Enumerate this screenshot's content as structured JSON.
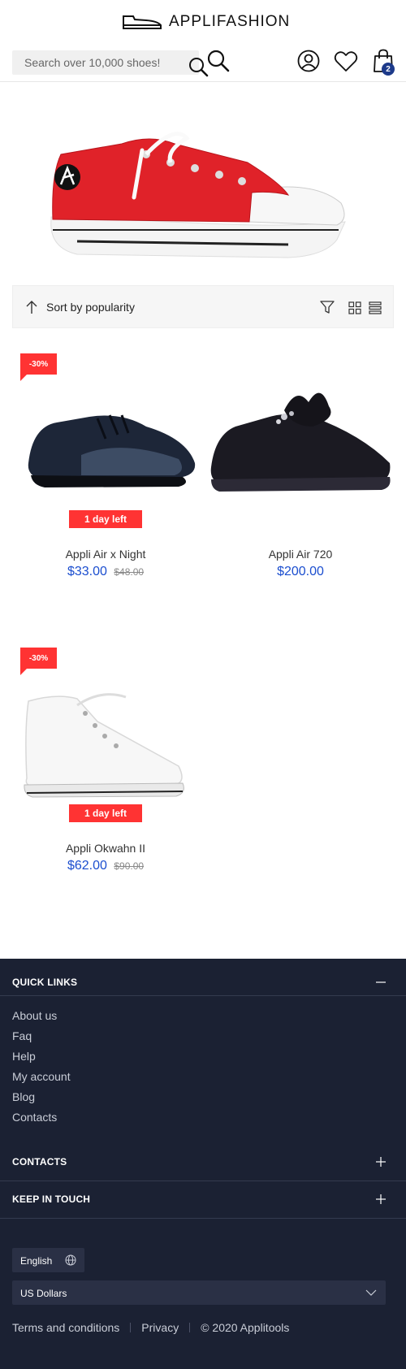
{
  "header": {
    "logo_text": "APPLIFASHION",
    "search_placeholder": "Search over 10,000 shoes!",
    "cart_count": "2",
    "icons": [
      "shoe-logo-icon",
      "search-icon",
      "account-icon",
      "heart-icon",
      "shopping-bag-icon"
    ]
  },
  "sortbar": {
    "label": "Sort by popularity",
    "icons": [
      "sort-arrow-icon",
      "filter-icon",
      "grid-view-icon",
      "list-view-icon"
    ]
  },
  "products": [
    {
      "discount": "-30%",
      "days_left": "1 day left",
      "name": "Appli Air x Night",
      "price": "$33.00",
      "old_price": "$48.00"
    },
    {
      "discount": "",
      "days_left": "",
      "name": "Appli Air 720",
      "price": "$200.00",
      "old_price": ""
    },
    {
      "discount": "-30%",
      "days_left": "1 day left",
      "name": "Appli Okwahn II",
      "price": "$62.00",
      "old_price": "$90.00"
    }
  ],
  "footer": {
    "quick_links_title": "QUICK LINKS",
    "quick_links": [
      "About us",
      "Faq",
      "Help",
      "My account",
      "Blog",
      "Contacts"
    ],
    "contacts_title": "CONTACTS",
    "keep_in_touch_title": "KEEP IN TOUCH",
    "language": "English",
    "currency": "US Dollars",
    "terms": "Terms and conditions",
    "privacy": "Privacy",
    "copyright": "© 2020 Applitools"
  },
  "colors": {
    "accent_red": "#ff3333",
    "price_blue": "#1b4ecf",
    "footer_bg": "#1b2133",
    "badge_blue": "#1d3a8a",
    "hero_shoe_red": "#e02229"
  }
}
